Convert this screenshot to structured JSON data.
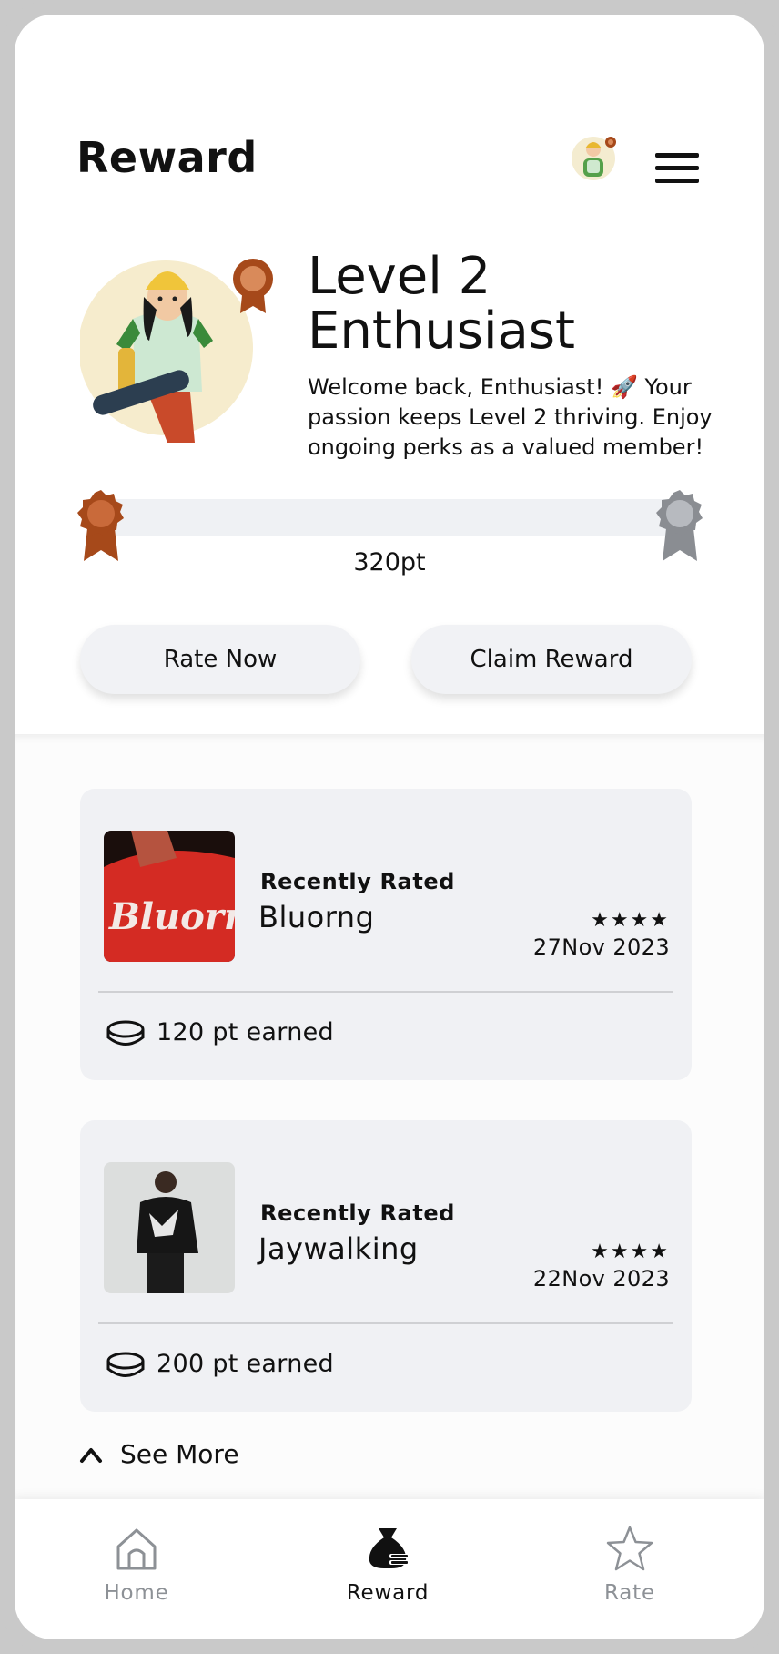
{
  "header": {
    "title": "Reward"
  },
  "level": {
    "title_line1": "Level 2",
    "title_line2": "Enthusiast",
    "description": "Welcome back, Enthusiast! 🚀 Your passion keeps Level 2 thriving. Enjoy ongoing perks as a valued member!",
    "points": "320pt",
    "progress_fraction": 0.0
  },
  "actions": {
    "rate_label": "Rate Now",
    "claim_label": "Claim Reward"
  },
  "cards": [
    {
      "kicker": "Recently Rated",
      "name": "Bluorng",
      "stars": "★★★★",
      "date": "27Nov 2023",
      "points": "120 pt earned",
      "thumb_text": "Bluorng"
    },
    {
      "kicker": "Recently Rated",
      "name": "Jaywalking",
      "stars": "★★★★",
      "date": "22Nov 2023",
      "points": "200 pt earned"
    }
  ],
  "see_more": "See More",
  "nav": {
    "home": "Home",
    "reward": "Reward",
    "rate": "Rate"
  },
  "colors": {
    "bronze": "#a6491a",
    "silver": "#8a8d92",
    "card_bg": "#f0f1f4"
  },
  "icons": {
    "menu": "hamburger-icon",
    "coin": "coin-icon",
    "chevron": "chevron-up-icon",
    "home": "home-icon",
    "reward": "money-bag-icon",
    "rate": "star-icon"
  }
}
